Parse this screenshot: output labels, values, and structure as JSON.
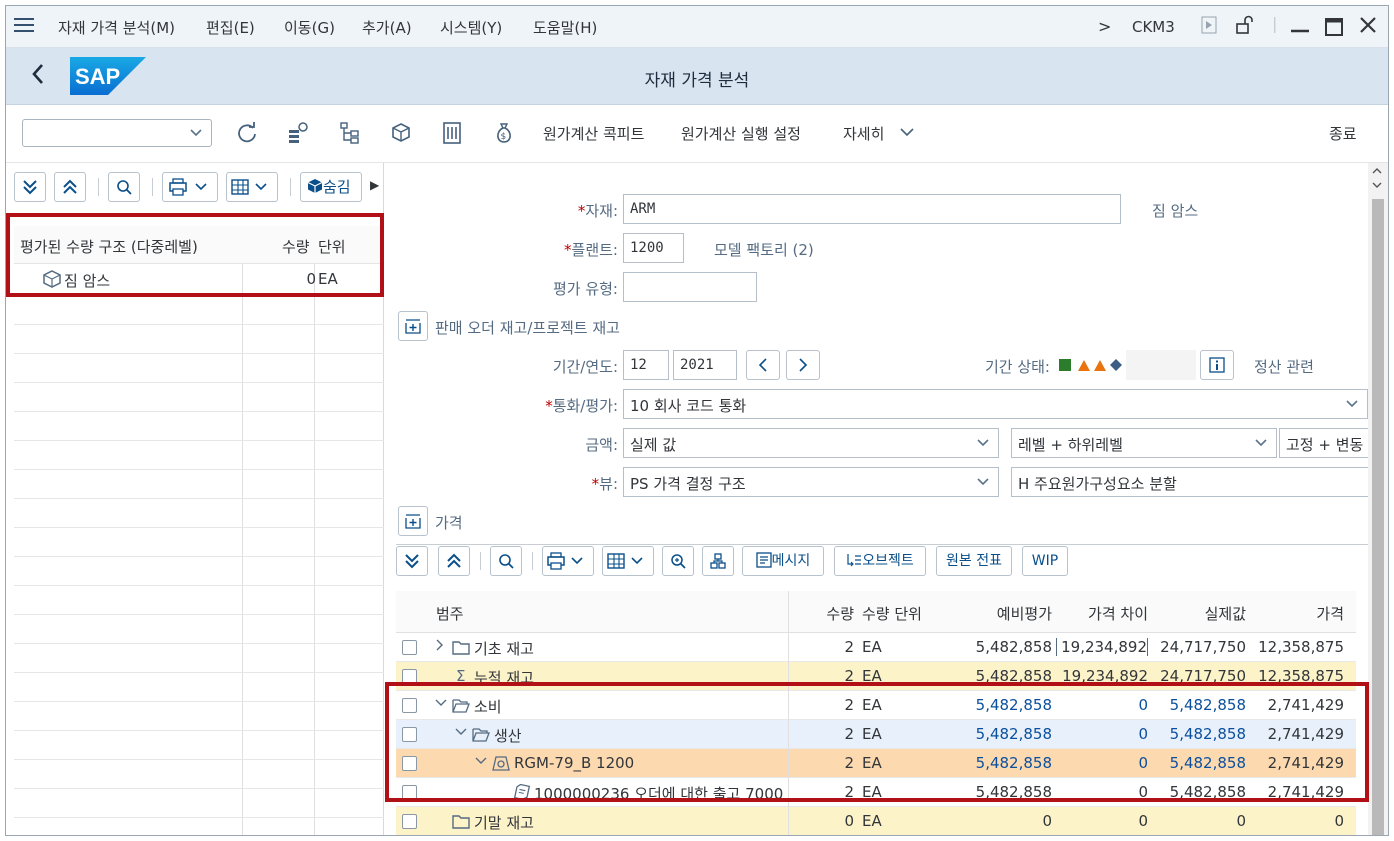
{
  "menu": {
    "items": [
      "자재 가격 분석(M)",
      "편집(E)",
      "이동(G)",
      "추가(A)",
      "시스템(Y)",
      "도움말(H)"
    ],
    "tcode": "CKM3"
  },
  "header": {
    "title": "자재 가격 분석"
  },
  "toolbar": {
    "select_value": "",
    "buttons": [
      "원가계산 콕피트",
      "원가계산 실행 설정",
      "자세히"
    ],
    "exit": "종료"
  },
  "left": {
    "hide_button": "숨김",
    "columns": {
      "structure": "평가된 수량 구조 (다중레벨)",
      "qty": "수량",
      "unit": "단위"
    },
    "row": {
      "name": "짐 암스",
      "qty": "0",
      "unit": "EA"
    }
  },
  "form": {
    "material_label": "자재:",
    "material_value": "ARM",
    "material_desc": "짐 암스",
    "plant_label": "플랜트:",
    "plant_value": "1200",
    "plant_desc": "모델 팩토리 (2)",
    "valtype_label": "평가 유형:",
    "valtype_value": "",
    "sales_order_label": "판매 오더 재고/프로젝트 재고",
    "period_label": "기간/연도:",
    "period_value": "12",
    "year_value": "2021",
    "period_status_label": "기간 상태:",
    "settlement": "정산 관련",
    "currency_label": "통화/평가:",
    "currency_value": "10 회사 코드 통화",
    "amount_label": "금액:",
    "amount_value": "실제 값",
    "level_value": "레벨 + 하위레벨",
    "fixvar_value": "고정 + 변동",
    "view_label": "뷰:",
    "view_value": "PS 가격 결정 구조",
    "view_desc": "H 주요원가구성요소 분할",
    "price_label": "가격"
  },
  "grid_toolbar": {
    "message": "메시지",
    "object": "오브젝트",
    "source_doc": "원본 전표",
    "wip": "WIP"
  },
  "grid": {
    "columns": [
      "범주",
      "수량",
      "수량 단위",
      "예비평가",
      "가격 차이",
      "실제값",
      "가격"
    ],
    "rows": [
      {
        "cat": "기초 재고",
        "qty": "2",
        "unit": "EA",
        "prelim": "5,482,858",
        "diff": "19,234,892",
        "actual": "24,717,750",
        "price": "12,358,875"
      },
      {
        "cat": "누적 재고",
        "qty": "2",
        "unit": "EA",
        "prelim": "5,482,858",
        "diff": "19,234,892",
        "actual": "24,717,750",
        "price": "12,358,875"
      },
      {
        "cat": "소비",
        "qty": "2",
        "unit": "EA",
        "prelim": "5,482,858",
        "diff": "0",
        "actual": "5,482,858",
        "price": "2,741,429"
      },
      {
        "cat": "생산",
        "qty": "2",
        "unit": "EA",
        "prelim": "5,482,858",
        "diff": "0",
        "actual": "5,482,858",
        "price": "2,741,429"
      },
      {
        "cat": "RGM-79_B 1200",
        "qty": "2",
        "unit": "EA",
        "prelim": "5,482,858",
        "diff": "0",
        "actual": "5,482,858",
        "price": "2,741,429"
      },
      {
        "cat": "1000000236 오더에 대한 출고 7000",
        "qty": "2",
        "unit": "EA",
        "prelim": "5,482,858",
        "diff": "0",
        "actual": "5,482,858",
        "price": "2,741,429"
      },
      {
        "cat": "기말 재고",
        "qty": "0",
        "unit": "EA",
        "prelim": "0",
        "diff": "0",
        "actual": "0",
        "price": "0"
      }
    ]
  },
  "colors": {
    "highlight_red": "#b11116",
    "yellow_row": "#fdf3c8",
    "orange_row": "#fdd9b0",
    "blue_row": "#e8f1fb"
  }
}
